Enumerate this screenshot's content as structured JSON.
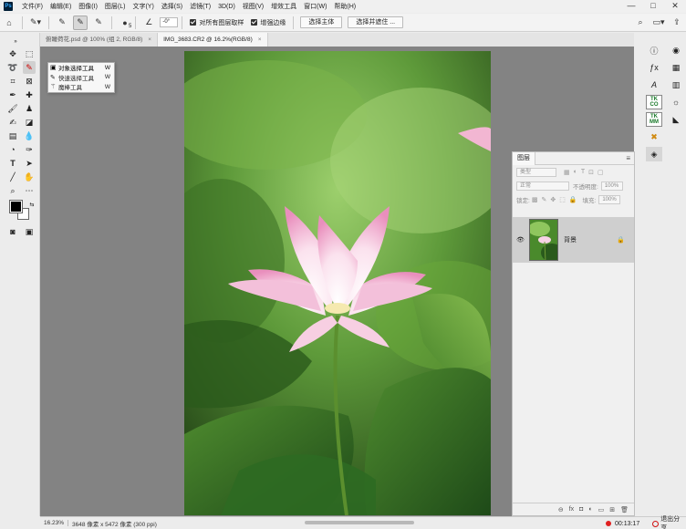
{
  "menubar": {
    "logo": "Ps",
    "items": [
      "文件(F)",
      "编辑(E)",
      "图像(I)",
      "图层(L)",
      "文字(Y)",
      "选择(S)",
      "滤镜(T)",
      "3D(D)",
      "视图(V)",
      "增效工具",
      "窗口(W)",
      "帮助(H)"
    ],
    "window_buttons": [
      "—",
      "□",
      "✕"
    ]
  },
  "options_bar": {
    "brush_size": "5",
    "angle_value": "-0°",
    "sample_all_layers": "对所有图层取样",
    "enhance_edge": "增强边缘",
    "select_subject": "选择主体",
    "select_and_mask": "选择并遮住 ..."
  },
  "tabs": [
    {
      "label": "俯瞰荷花.psd @ 100% (组 2, RGB/8)",
      "close": "×",
      "active": false
    },
    {
      "label": "IMG_3683.CR2 @ 16.2%(RGB/8)",
      "close": "×",
      "active": true
    }
  ],
  "flyout": {
    "items": [
      {
        "label": "对象选择工具",
        "key": "W",
        "icon": "object-select-icon"
      },
      {
        "label": "快速选择工具",
        "key": "W",
        "icon": "quick-select-icon"
      },
      {
        "label": "魔棒工具",
        "key": "W",
        "icon": "magic-wand-icon"
      }
    ]
  },
  "layers_panel": {
    "title": "图层",
    "filter_placeholder": "类型",
    "blend_mode": "正常",
    "opacity_label": "不透明度:",
    "opacity_value": "100%",
    "lock_label": "锁定:",
    "fill_label": "填充:",
    "fill_value": "100%",
    "layer_name": "背景",
    "footer_icons": [
      "link-icon",
      "fx-icon",
      "mask-icon",
      "adjustment-icon",
      "group-icon",
      "new-layer-icon",
      "trash-icon"
    ],
    "footer_glyphs": [
      "⊖",
      "fx",
      "◘",
      "◐",
      "▭",
      "⊞",
      "🗑"
    ]
  },
  "statusbar": {
    "zoom": "16.23%",
    "doc_info": "3648 像素 x 5472 像素 (300 ppi)",
    "timer": "00:13:17",
    "exit_share": "退出分享"
  },
  "colors": {
    "canvas_bg": "#838383",
    "accent_red": "#e02020",
    "leaf_green": "#3f7a28",
    "petal_pink": "#f2b6d2"
  }
}
